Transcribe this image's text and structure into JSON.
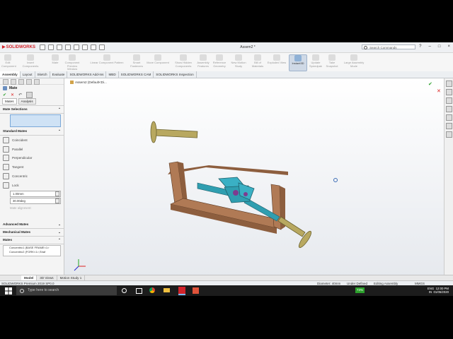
{
  "app": {
    "logo_text": "SOLIDWORKS",
    "document_title": "Assem2 *",
    "search_placeholder": "Search Commands",
    "window_controls": [
      "?",
      "–",
      "□",
      "×"
    ]
  },
  "ribbon": {
    "buttons": [
      {
        "label": "Edit Component",
        "icon": "edit-component-icon"
      },
      {
        "label": "Insert Components",
        "icon": "insert-components-icon"
      },
      {
        "label": "Mate",
        "icon": "mate-icon"
      },
      {
        "label": "Component Preview Window",
        "icon": "preview-window-icon"
      },
      {
        "label": "Linear Component Pattern",
        "icon": "pattern-icon"
      },
      {
        "label": "Smart Fasteners",
        "icon": "fastener-icon"
      },
      {
        "label": "Move Component",
        "icon": "move-component-icon"
      },
      {
        "label": "Show Hidden Components",
        "icon": "show-hidden-icon"
      },
      {
        "label": "Assembly Features",
        "icon": "assembly-features-icon"
      },
      {
        "label": "Reference Geometry",
        "icon": "reference-geometry-icon"
      },
      {
        "label": "New Motion Study",
        "icon": "motion-study-icon"
      },
      {
        "label": "Bill of Materials",
        "icon": "bom-icon"
      },
      {
        "label": "Exploded View",
        "icon": "exploded-view-icon"
      },
      {
        "label": "Instant3D",
        "icon": "instant3d-icon",
        "active": true
      },
      {
        "label": "Update Speedpak",
        "icon": "speedpak-icon"
      },
      {
        "label": "Take Snapshot",
        "icon": "snapshot-icon"
      },
      {
        "label": "Large Assembly Mode",
        "icon": "large-assembly-icon"
      }
    ]
  },
  "command_tabs": [
    "Assembly",
    "Layout",
    "Sketch",
    "Evaluate",
    "SOLIDWORKS Add-Ins",
    "MBD",
    "SOLIDWORKS CAM",
    "SOLIDWORKS Inspection"
  ],
  "panel": {
    "title": "Mate",
    "subtabs": [
      "Mates",
      "Analysis"
    ],
    "mate_selections_label": "Mate Selections",
    "standard_mates_label": "Standard Mates",
    "standard_mates": [
      {
        "label": "Coincident",
        "icon": "coincident-icon"
      },
      {
        "label": "Parallel",
        "icon": "parallel-icon"
      },
      {
        "label": "Perpendicular",
        "icon": "perpendicular-icon"
      },
      {
        "label": "Tangent",
        "icon": "tangent-icon"
      },
      {
        "label": "Concentric",
        "icon": "concentric-icon"
      },
      {
        "label": "Lock",
        "icon": "lock-icon"
      }
    ],
    "distance_value": "1.00mm",
    "angle_value": "30.00deg",
    "mate_alignment_label": "Mate alignment:",
    "advanced_mates_label": "Advanced Mates",
    "mechanical_mates_label": "Mechanical Mates",
    "mates_label": "Mates",
    "mates_list": [
      "Concentric1 (BASE FRAME<1>",
      "Concentric2 (FORK<1>,Shaf"
    ]
  },
  "viewport": {
    "tree_label": "Assem2 (Default<Di..."
  },
  "bottom_tabs": [
    "Model",
    "3D Views",
    "Motion Study 1"
  ],
  "status": {
    "product": "SOLIDWORKS Premium 2019 SP0.0",
    "measure": "Diameter: 40mm",
    "definition": "Under Defined",
    "mode": "Editing Assembly",
    "units": "MMGS"
  },
  "taskbar": {
    "search_placeholder": "Type here to search",
    "battery": "73%",
    "language": "ENG",
    "region": "IN",
    "time": "12:00 PM",
    "date": "01/05/2020"
  },
  "colors": {
    "frame": "#b07a55",
    "shaft": "#b8a860",
    "yoke": "#2f9eb0",
    "accent_red": "#d2232a"
  }
}
